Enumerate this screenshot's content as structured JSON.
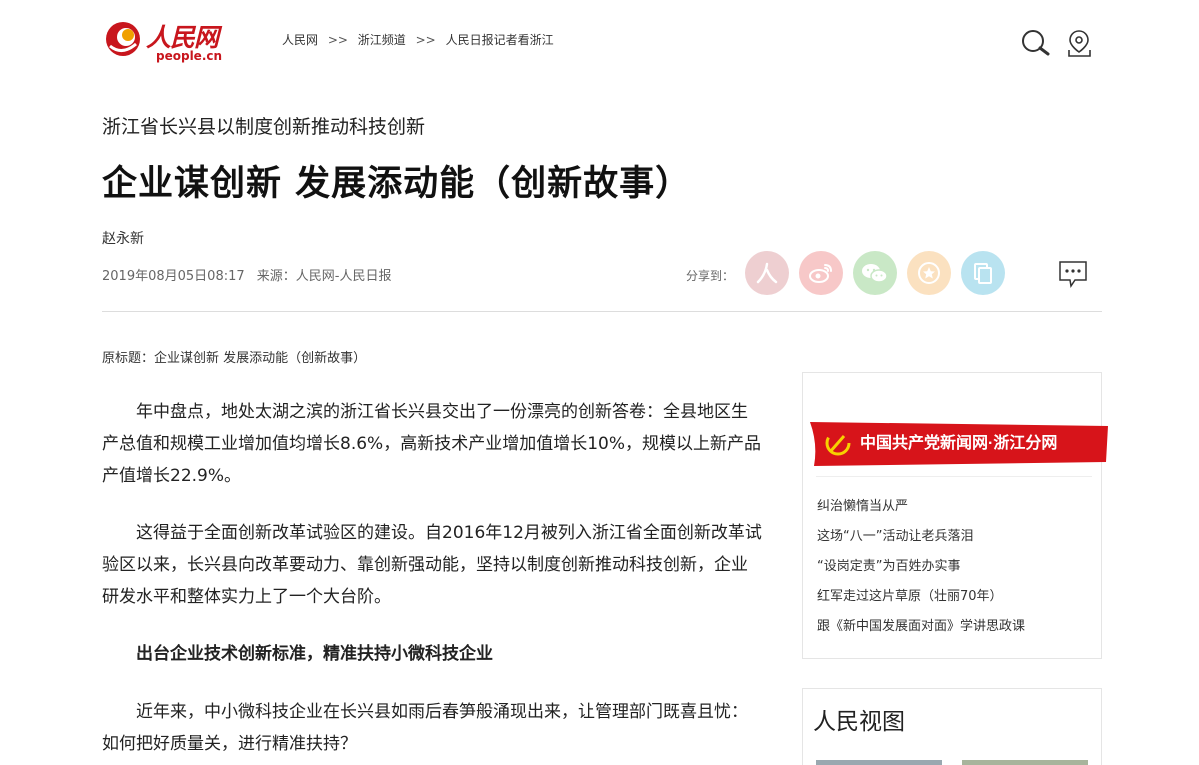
{
  "header": {
    "logo_cn": "人民网",
    "logo_en": "people.cn",
    "breadcrumb": [
      "人民网",
      "浙江频道",
      "人民日报记者看浙江"
    ],
    "breadcrumb_sep": ">>",
    "icons": [
      "search-icon",
      "location-icon"
    ]
  },
  "article": {
    "subtitle": "浙江省长兴县以制度创新推动科技创新",
    "title": "企业谋创新 发展添动能（创新故事）",
    "author": "赵永新",
    "datetime": "2019年08月05日08:17",
    "source": "来源：人民网-人民日报",
    "original_title": "原标题：企业谋创新 发展添动能（创新故事）",
    "paragraphs": [
      "年中盘点，地处太湖之滨的浙江省长兴县交出了一份漂亮的创新答卷：全县地区生产总值和规模工业增加值均增长8.6%，高新技术产业增加值增长10%，规模以上新产品产值增长22.9%。",
      "这得益于全面创新改革试验区的建设。自2016年12月被列入浙江省全面创新改革试验区以来，长兴县向改革要动力、靠创新强动能，坚持以制度创新推动科技创新，企业研发水平和整体实力上了一个大台阶。",
      "出台企业技术创新标准，精准扶持小微科技企业",
      "近年来，中小微科技企业在长兴县如雨后春笋般涌现出来，让管理部门既喜且忧：如何把好质量关，进行精准扶持？"
    ]
  },
  "share": {
    "label": "分享到：",
    "buttons": [
      {
        "name": "share-people-button",
        "icon": "people-icon",
        "color": "#eecfd1"
      },
      {
        "name": "share-weibo-button",
        "icon": "weibo-icon",
        "color": "#f7c8c8"
      },
      {
        "name": "share-wechat-button",
        "icon": "wechat-icon",
        "color": "#c9e8c6"
      },
      {
        "name": "share-favorite-button",
        "icon": "star-icon",
        "color": "#fbe1c0"
      },
      {
        "name": "share-copy-button",
        "icon": "copy-icon",
        "color": "#b9e3f0"
      }
    ]
  },
  "sidebar": {
    "banner_text": "中国共产党新闻网·浙江分网",
    "links": [
      "纠治懒惰当从严",
      "这场“八一”活动让老兵落泪",
      "“设岗定责”为百姓办实事",
      "红军走过这片草原（壮丽70年）",
      "跟《新中国发展面对面》学讲思政课"
    ],
    "section2_title": "人民视图"
  },
  "colors": {
    "brand_red": "#c8161d",
    "text": "#222222"
  }
}
